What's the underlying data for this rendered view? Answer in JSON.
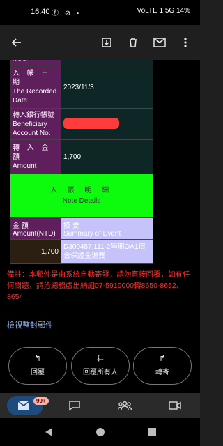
{
  "status_bar": {
    "time": "16:40",
    "right_text": "VoLTE 1 5G  14%"
  },
  "app_bar": {
    "icons": [
      "back-arrow-icon",
      "archive-icon",
      "delete-icon",
      "mail-icon",
      "more-vert-icon"
    ]
  },
  "mail_table": {
    "partial_label": "Name",
    "recorded_date_label_zh": "入 帳 日 期",
    "recorded_date_label_en": "The Recorded Date",
    "recorded_date_value": "2023/11/3",
    "account_label_zh": "轉入銀行帳號",
    "account_label_en": "Beneficiary Account No.",
    "transfer_amount_label_zh": "轉 入 金 額",
    "transfer_amount_label_en": "Amount",
    "transfer_amount_value": "1,700",
    "details_header_zh": "入 帳 明 細",
    "details_header_en": "Note Details",
    "amount_col_zh": "金 額",
    "amount_col_en": "Amount(NTD)",
    "summary_col_zh": "摘 要",
    "summary_col_en": "Summary of Event",
    "row_amount": "1,700",
    "row_summary": "D300457,111-2學期OA1宿舍保證金退費"
  },
  "note": "備註：本郵件是由系統自動寄發，請勿直接回覆，如有任何問題，請洽總務處出納組07-5919000轉8650-8652、8654",
  "view_all": "檢視整封郵件",
  "actions": {
    "reply": "回覆",
    "reply_all": "回覆所有人",
    "forward": "轉寄"
  },
  "bottom_nav": {
    "badge": "99+"
  }
}
